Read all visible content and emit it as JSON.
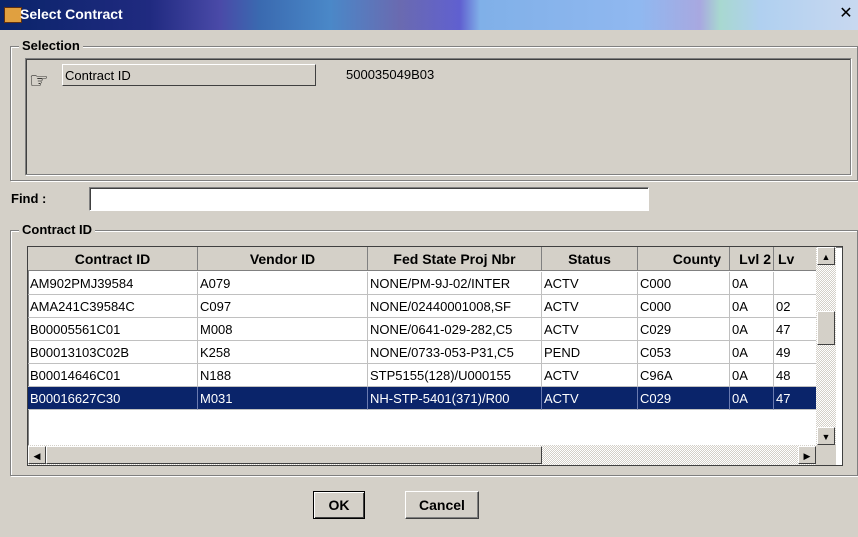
{
  "window": {
    "title": "Select Contract",
    "close_glyph": "✕"
  },
  "selection": {
    "legend": "Selection",
    "button_label": "Contract ID",
    "value": "500035049B03",
    "icon": "pointing-hand-icon"
  },
  "find": {
    "label": "Find :",
    "value": ""
  },
  "results": {
    "legend": "Contract ID",
    "columns": [
      "Contract ID",
      "Vendor ID",
      "Fed State Proj Nbr",
      "Status",
      "County",
      "Lvl 2",
      "Lv"
    ],
    "rows": [
      [
        "AM902PMJ39584",
        "A079",
        "NONE/PM-9J-02/INTER",
        "ACTV",
        "C000",
        "0A",
        ""
      ],
      [
        "AMA241C39584C",
        "C097",
        "NONE/02440001008,SF",
        "ACTV",
        "C000",
        "0A",
        "02"
      ],
      [
        "B00005561C01",
        "M008",
        "NONE/0641-029-282,C5",
        "ACTV",
        "C029",
        "0A",
        "47"
      ],
      [
        "B00013103C02B",
        "K258",
        "NONE/0733-053-P31,C5",
        "PEND",
        "C053",
        "0A",
        "49"
      ],
      [
        "B00014646C01",
        "N188",
        "STP5155(128)/U000155",
        "ACTV",
        "C96A",
        "0A",
        "48"
      ],
      [
        "B00016627C30",
        "M031",
        "NH-STP-5401(371)/R00",
        "ACTV",
        "C029",
        "0A",
        "47"
      ]
    ],
    "selected_row": 5
  },
  "buttons": {
    "ok": "OK",
    "cancel": "Cancel"
  },
  "colors": {
    "selection": "#0a246a",
    "face": "#d4d0c8"
  }
}
